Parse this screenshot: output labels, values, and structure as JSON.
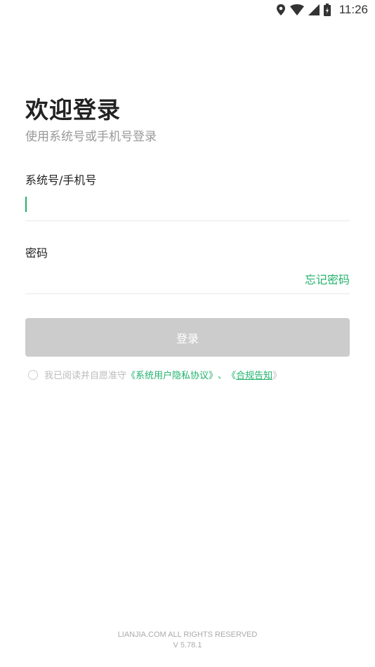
{
  "status_bar": {
    "time": "11:26",
    "icons": [
      "location-icon",
      "wifi-icon",
      "cell-signal-icon",
      "battery-icon"
    ]
  },
  "login": {
    "title": "欢迎登录",
    "subtitle": "使用系统号或手机号登录",
    "account_label": "系统号/手机号",
    "account_value": "",
    "password_label": "密码",
    "password_value": "",
    "forgot_password": "忘记密码",
    "login_button": "登录"
  },
  "agreement": {
    "prefix": "我已阅读并自愿准守",
    "privacy_link": "《系统用户隐私协议》",
    "separator": "、",
    "compliance_open": "《",
    "compliance_link": "合规告知",
    "compliance_close": "》",
    "checked": false
  },
  "footer": {
    "copyright": "LIANJIA.COM ALL RIGHTS RESERVED",
    "version": "V 5.78.1"
  },
  "colors": {
    "accent": "#20b26b",
    "button_disabled": "#cccccc",
    "title": "#222222",
    "subtitle": "#999999"
  }
}
